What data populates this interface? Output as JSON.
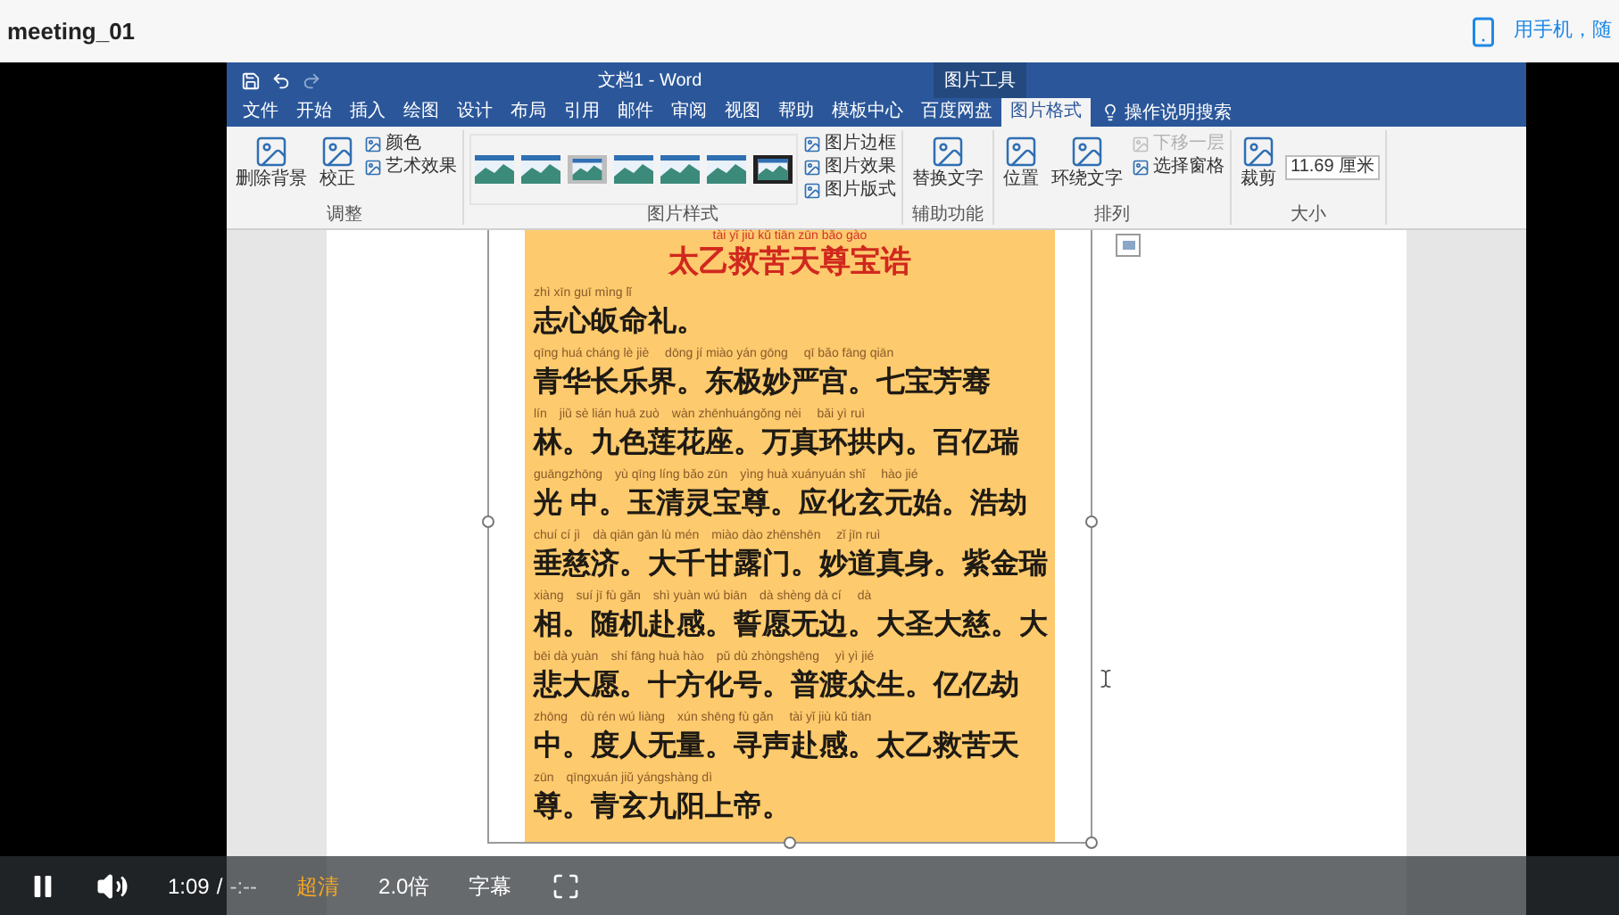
{
  "page": {
    "title": "meeting_01",
    "mobile_link": "用手机，随"
  },
  "word": {
    "title": "文档1 - Word",
    "context_tab": "图片工具",
    "tabs": [
      {
        "label": "文件",
        "selected": false
      },
      {
        "label": "开始",
        "selected": false
      },
      {
        "label": "插入",
        "selected": false
      },
      {
        "label": "绘图",
        "selected": false
      },
      {
        "label": "设计",
        "selected": false
      },
      {
        "label": "布局",
        "selected": false
      },
      {
        "label": "引用",
        "selected": false
      },
      {
        "label": "邮件",
        "selected": false
      },
      {
        "label": "审阅",
        "selected": false
      },
      {
        "label": "视图",
        "selected": false
      },
      {
        "label": "帮助",
        "selected": false
      },
      {
        "label": "模板中心",
        "selected": false
      },
      {
        "label": "百度网盘",
        "selected": false
      },
      {
        "label": "图片格式",
        "selected": true
      }
    ],
    "search": "操作说明搜索",
    "groups": [
      {
        "label": "调整",
        "items": [
          {
            "kind": "large",
            "label": "删除背景"
          },
          {
            "kind": "large",
            "label": "校正"
          },
          {
            "kind": "small",
            "label": "颜色",
            "disabled": false
          },
          {
            "kind": "small",
            "label": "艺术效果",
            "disabled": false
          }
        ]
      },
      {
        "label": "图片样式",
        "items": [
          {
            "kind": "gallery"
          },
          {
            "kind": "small",
            "label": "图片边框",
            "disabled": false
          },
          {
            "kind": "small",
            "label": "图片效果",
            "disabled": false
          },
          {
            "kind": "small",
            "label": "图片版式",
            "disabled": false
          }
        ]
      },
      {
        "label": "辅助功能",
        "items": [
          {
            "kind": "large",
            "label": "替换文字"
          }
        ]
      },
      {
        "label": "排列",
        "items": [
          {
            "kind": "large",
            "label": "位置"
          },
          {
            "kind": "large",
            "label": "环绕文字"
          },
          {
            "kind": "small",
            "label": "下移一层",
            "disabled": true
          },
          {
            "kind": "small",
            "label": "选择窗格",
            "disabled": false
          }
        ]
      },
      {
        "label": "大小",
        "items": [
          {
            "kind": "large",
            "label": "裁剪"
          },
          {
            "kind": "field",
            "label": "11.69 厘米"
          }
        ]
      }
    ]
  },
  "document": {
    "title_pinyin": "tài yǐ jiù kǔ tiān zūn bǎo gào",
    "title": "太乙救苦天尊宝诰",
    "lines": [
      {
        "pinyin": "zhì xīn guī mìng lǐ",
        "text": "志心皈命礼。"
      },
      {
        "pinyin": "qīng huá cháng lè jiè　 dōng jí miào yán gōng　 qī bǎo fāng qiān",
        "text": "青华长乐界。东极妙严宫。七宝芳骞"
      },
      {
        "pinyin": "lín　jiǔ sè lián huā zuò　wàn zhēnhuángǒng nèi　 bǎi yì ruì",
        "text": "林。九色莲花座。万真环拱内。百亿瑞"
      },
      {
        "pinyin": "guāngzhōng　yù qīng líng bǎo zūn　yìng huà xuányuán shǐ　 hào jié",
        "text": "光 中。玉清灵宝尊。应化玄元始。浩劫"
      },
      {
        "pinyin": "chuí cí jì　dà qiān gān lù mén　miào dào zhēnshēn　 zǐ jīn ruì",
        "text": "垂慈济。大千甘露门。妙道真身。紫金瑞"
      },
      {
        "pinyin": "xiàng　suí jī fù gǎn　shì yuàn wú biān　dà shèng dà cí　 dà",
        "text": "相。随机赴感。誓愿无边。大圣大慈。大"
      },
      {
        "pinyin": "bēi dà yuàn　shí fāng huà hào　pǔ dù zhòngshēng　 yì yì jié",
        "text": "悲大愿。十方化号。普渡众生。亿亿劫"
      },
      {
        "pinyin": "zhōng　dù rén wú liàng　xún shēng fù gǎn　 tài yǐ jiù kǔ tiān",
        "text": "中。度人无量。寻声赴感。太乙救苦天"
      },
      {
        "pinyin": "zūn　qīngxuán jiǔ yángshàng dì",
        "text": "尊。青玄九阳上帝。"
      }
    ]
  },
  "player": {
    "playing": true,
    "time": "1:09",
    "separator": "/",
    "duration": "-:--",
    "quality": "超清",
    "speed": "2.0倍",
    "subtitles": "字幕"
  }
}
